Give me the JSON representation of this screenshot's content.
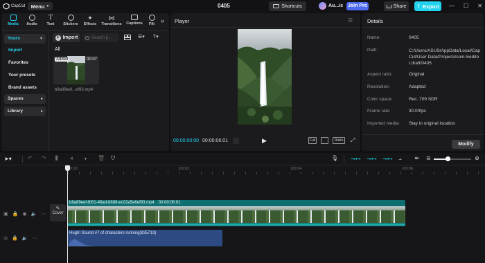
{
  "app": {
    "name": "CapCut",
    "menu_label": "Menu",
    "project_title": "0405",
    "shortcuts_label": "Shortcuts",
    "user_label": "Au...is",
    "join_pro_label": "Join Pro",
    "share_label": "Share",
    "export_label": "Export"
  },
  "media_tabs": [
    {
      "label": "Media",
      "icon": "media-icon"
    },
    {
      "label": "Audio",
      "icon": "audio-icon"
    },
    {
      "label": "Text",
      "icon": "text-icon"
    },
    {
      "label": "Stickers",
      "icon": "stickers-icon"
    },
    {
      "label": "Effects",
      "icon": "effects-icon"
    },
    {
      "label": "Transitions",
      "icon": "transitions-icon"
    },
    {
      "label": "Captions",
      "icon": "captions-icon"
    },
    {
      "label": "Filt",
      "icon": "filters-icon"
    }
  ],
  "sidebar": {
    "yours": "Yours",
    "items": [
      "Import",
      "Favorites",
      "Your presets",
      "Brand assets"
    ],
    "spaces": "Spaces",
    "library": "Library"
  },
  "media": {
    "import_label": "Import",
    "search_placeholder": "Search p...",
    "filter_label": "All",
    "clip": {
      "badge": "Added",
      "duration": "00:07",
      "name": "b8a89eef...ef93.mp4"
    }
  },
  "player": {
    "title": "Player",
    "current_time": "00:00:00:00",
    "total_time": "00:00:06:01",
    "full_label": "Full",
    "ratio_label": "Ratio"
  },
  "details": {
    "title": "Details",
    "rows": [
      {
        "label": "Name:",
        "value": "0405"
      },
      {
        "label": "Path:",
        "value": "C:/Users/ASUS/AppData/Local/CapCut/User Data/Projects/com.lveditor.draft/0405"
      },
      {
        "label": "Aspect ratio:",
        "value": "Original"
      },
      {
        "label": "Resolution:",
        "value": "Adapted"
      },
      {
        "label": "Color space:",
        "value": "Rec. 709 SDR"
      },
      {
        "label": "Frame rate:",
        "value": "30.00fps"
      },
      {
        "label": "Imported media:",
        "value": "Stay in original location"
      }
    ],
    "modify_label": "Modify"
  },
  "timeline": {
    "ruler": [
      "00:00",
      "|00:02",
      "|00:04",
      "|00:06"
    ],
    "cover_label": "Cover",
    "video_clip": {
      "name": "b8a89eef-fb51-46ad-8889-ec02a5e6ef93.mp4",
      "duration": "00:00:06:01"
    },
    "audio_clip": {
      "name": "Hugh! Sound #7 of characters running(835719)"
    }
  },
  "colors": {
    "accent": "#22d3ee",
    "video_clip": "#0f6f70",
    "audio_clip": "#2d4a82",
    "join_pro": "#4e6af0"
  }
}
